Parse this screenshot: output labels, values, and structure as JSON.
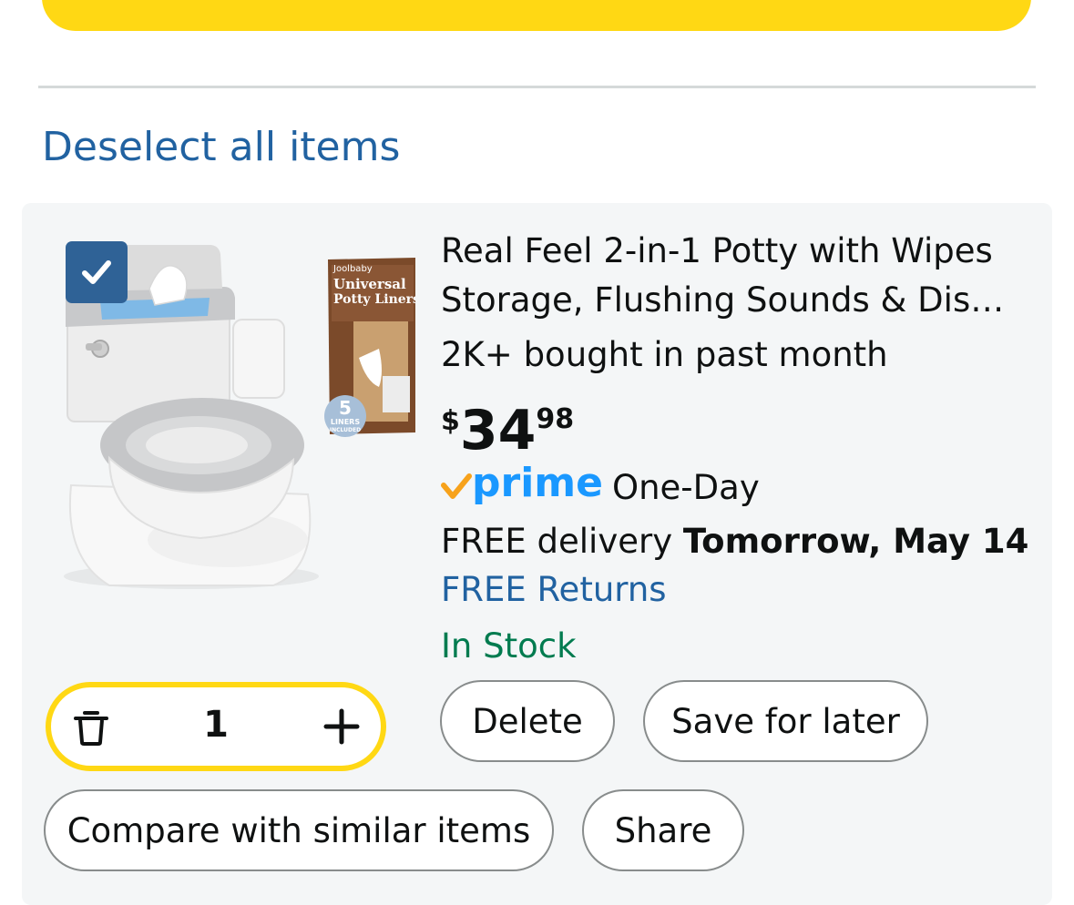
{
  "deselect_all_label": "Deselect all items",
  "item": {
    "title_line1": "Real Feel 2-in-1 Potty with Wipes",
    "title_line2": "Storage, Flushing Sounds & Dis…",
    "bought": "2K+ bought in past month",
    "price": {
      "symbol": "$",
      "whole": "34",
      "fraction": "98"
    },
    "prime_label": "prime",
    "prime_suffix": "One-Day",
    "delivery_prefix": "FREE delivery ",
    "delivery_date": "Tomorrow, May 14",
    "returns": "FREE Returns",
    "stock": "In Stock",
    "quantity": "1",
    "checked": true,
    "package_text": {
      "brand": "Joolbaby",
      "line1": "Universal",
      "line2": "Potty Liners",
      "badge_number": "5",
      "badge_text1": "LINERS",
      "badge_text2": "INCLUDED"
    }
  },
  "actions": {
    "delete": "Delete",
    "save_for_later": "Save for later",
    "compare": "Compare with similar items",
    "share": "Share"
  },
  "colors": {
    "yellow": "#ffd814",
    "link_blue": "#2162a1",
    "prime_blue": "#1a98ff",
    "prime_check": "#f7a21b",
    "stock_green": "#007b4f",
    "checkbox_blue": "#2f6296"
  }
}
